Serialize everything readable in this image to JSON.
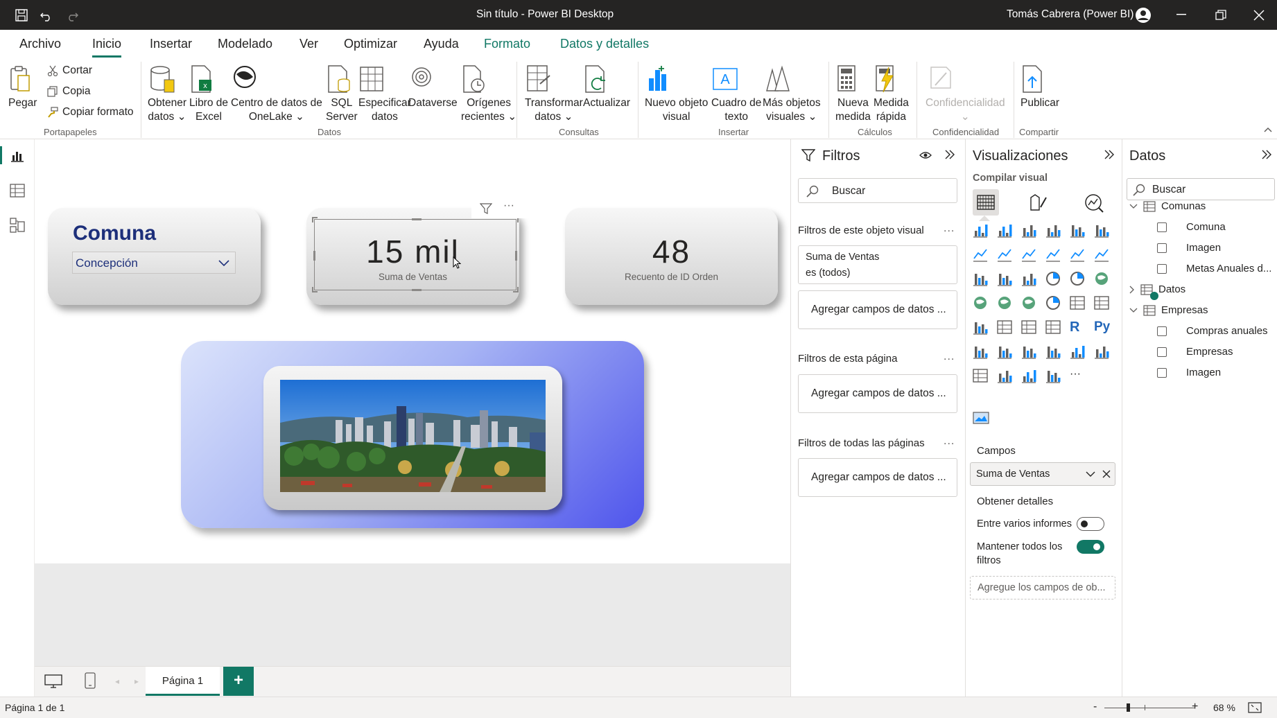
{
  "titlebar": {
    "title": "Sin título - Power BI Desktop",
    "user": "Tomás Cabrera (Power BI)"
  },
  "menu": [
    "Archivo",
    "Inicio",
    "Insertar",
    "Modelado",
    "Ver",
    "Optimizar",
    "Ayuda",
    "Formato",
    "Datos y detalles"
  ],
  "ribbon": {
    "clipboard": {
      "paste": "Pegar",
      "cut": "Cortar",
      "copy": "Copia",
      "format_painter": "Copiar formato",
      "group": "Portapapeles"
    },
    "data": {
      "get_data": [
        "Obtener",
        "datos ⌄"
      ],
      "excel": [
        "Libro de",
        "Excel"
      ],
      "onelake": [
        "Centro de datos de",
        "OneLake ⌄"
      ],
      "sql": [
        "SQL",
        "Server"
      ],
      "enter_data": [
        "Especificar",
        "datos"
      ],
      "dataverse": [
        "Dataverse",
        ""
      ],
      "recent": [
        "Orígenes",
        "recientes ⌄"
      ],
      "group": "Datos"
    },
    "queries": {
      "transform": [
        "Transformar",
        "datos ⌄"
      ],
      "refresh": [
        "Actualizar",
        ""
      ],
      "group": "Consultas"
    },
    "insert": {
      "new_visual": [
        "Nuevo objeto",
        "visual"
      ],
      "text_box": [
        "Cuadro de",
        "texto"
      ],
      "more_visuals": [
        "Más objetos",
        "visuales ⌄"
      ],
      "group": "Insertar"
    },
    "calculations": {
      "new_measure": [
        "Nueva",
        "medida"
      ],
      "quick_measure": [
        "Medida",
        "rápida"
      ],
      "group": "Cálculos"
    },
    "sensitivity": {
      "label": "Confidencialidad",
      "arrow": "⌄",
      "group": "Confidencialidad"
    },
    "share": {
      "publish": "Publicar",
      "group": "Compartir"
    }
  },
  "canvas": {
    "slicer": {
      "title": "Comuna",
      "value": "Concepción"
    },
    "card1": {
      "value": "15 mil",
      "label": "Suma de Ventas"
    },
    "card2": {
      "value": "48",
      "label": "Recuento de ID Orden"
    }
  },
  "pages": {
    "tab": "Página 1",
    "add": "+"
  },
  "status": {
    "page": "Página 1 de 1",
    "zoom": "68 %",
    "zoom_minus": "-",
    "zoom_plus": "+"
  },
  "filters": {
    "title": "Filtros",
    "search": "Buscar",
    "visual_section": "Filtros de este objeto visual",
    "filter_card": {
      "line1": "Suma de Ventas",
      "line2": "es (todos)"
    },
    "add_fields": "Agregar campos de datos ...",
    "page_section": "Filtros de esta página",
    "all_section": "Filtros de todas las páginas",
    "dots": "..."
  },
  "visualizations": {
    "title": "Visualizaciones",
    "build": "Compilar visual",
    "fields_label": "Campos",
    "field": "Suma de Ventas",
    "drill": "Obtener detalles",
    "cross_report": "Entre varios informes",
    "cross_report_on": false,
    "keep_filters": [
      "Mantener todos los",
      "filtros"
    ],
    "keep_filters_on": true,
    "drop_hint": "Agregue los campos de ob...",
    "more": "···",
    "r_icon": "R",
    "py_icon": "Py"
  },
  "data_pane": {
    "title": "Datos",
    "search": "Buscar",
    "tables": [
      {
        "name": "Comunas",
        "expanded": true,
        "fields": [
          "Comuna",
          "Imagen",
          "Metas Anuales d..."
        ]
      },
      {
        "name": "Datos",
        "expanded": false,
        "fields": []
      },
      {
        "name": "Empresas",
        "expanded": true,
        "fields": [
          "Compras anuales",
          "Empresas",
          "Imagen"
        ]
      }
    ]
  },
  "colors": {
    "accent": "#117865",
    "titlebar": "#252423",
    "slicer_title": "#1d2f7a",
    "toggle_on": "#117865"
  }
}
